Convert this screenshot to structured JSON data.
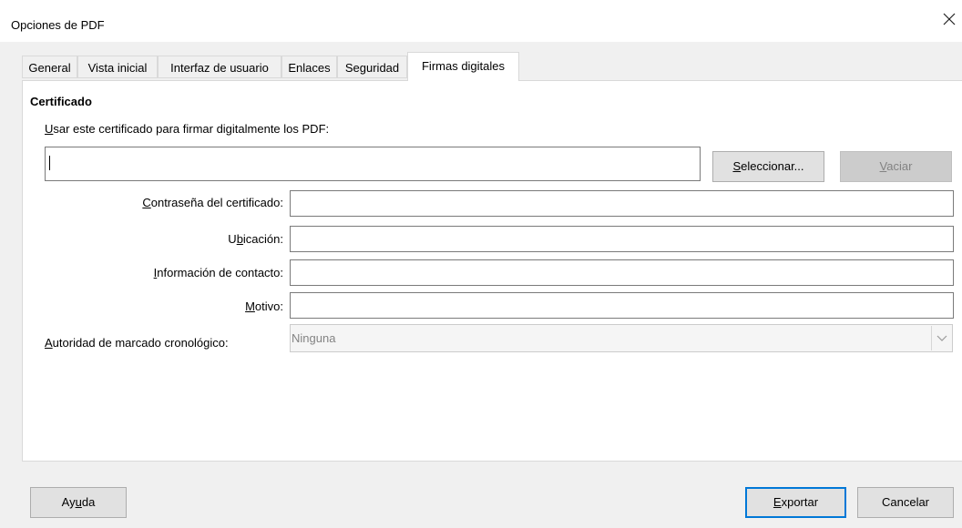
{
  "window": {
    "title": "Opciones de PDF",
    "close_icon": "close-icon"
  },
  "tabs": [
    {
      "label": "General",
      "active": false
    },
    {
      "label": "Vista inicial",
      "active": false
    },
    {
      "label": "Interfaz de usuario",
      "active": false
    },
    {
      "label": "Enlaces",
      "active": false
    },
    {
      "label": "Seguridad",
      "active": false
    },
    {
      "label": "Firmas digitales",
      "active": true
    }
  ],
  "certificate": {
    "section_title": "Certificado",
    "use_label_accel": "U",
    "use_label_rest": "sar este certificado para firmar digitalmente los PDF:",
    "field_value": "",
    "select_button_accel": "S",
    "select_button_rest": "eleccionar...",
    "clear_button_accel": "V",
    "clear_button_rest": "aciar"
  },
  "fields": {
    "password_label_accel": "C",
    "password_label_rest": "ontraseña del certificado:",
    "password_value": "",
    "location_label_pre": "U",
    "location_label_accel": "b",
    "location_label_rest": "icación:",
    "location_value": "",
    "contact_label_accel": "I",
    "contact_label_rest": "nformación de contacto:",
    "contact_value": "",
    "reason_label_accel": "M",
    "reason_label_rest": "otivo:",
    "reason_value": "",
    "tsa_label_accel": "A",
    "tsa_label_rest": "utoridad de marcado cronológico:",
    "tsa_value": "Ninguna"
  },
  "footer": {
    "help_pre": "Ay",
    "help_accel": "u",
    "help_rest": "da",
    "export_pre": "",
    "export_accel": "E",
    "export_rest": "xportar",
    "cancel_label": "Cancelar"
  },
  "colors": {
    "accent": "#0078d7",
    "panel": "#ffffff",
    "window_bg": "#f0f0f0"
  }
}
